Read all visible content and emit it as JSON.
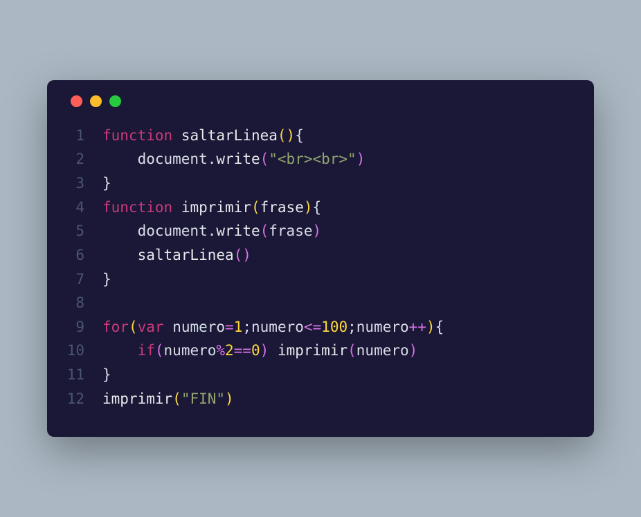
{
  "window": {
    "dots": [
      "red",
      "yellow",
      "green"
    ]
  },
  "code": {
    "lines": [
      {
        "no": "1",
        "tokens": [
          [
            "kw",
            "function"
          ],
          [
            "",
            ", "
          ],
          [
            "fn",
            "saltarLinea"
          ],
          [
            "paren-y",
            "()"
          ],
          [
            "punct",
            "{"
          ]
        ],
        "indent": 0
      },
      {
        "no": "2",
        "tokens": [
          [
            "",
            "document"
          ],
          [
            "punct",
            "."
          ],
          [
            "fn",
            "write"
          ],
          [
            "paren-p",
            "("
          ],
          [
            "str",
            "\"<br><br>\""
          ],
          [
            "paren-p",
            ")"
          ]
        ],
        "indent": 1
      },
      {
        "no": "3",
        "tokens": [
          [
            "punct",
            "}"
          ]
        ],
        "indent": 0
      },
      {
        "no": "4",
        "tokens": [
          [
            "kw",
            "function"
          ],
          [
            "",
            ", "
          ],
          [
            "fn",
            "imprimir"
          ],
          [
            "paren-y",
            "("
          ],
          [
            "param",
            "frase"
          ],
          [
            "paren-y",
            ")"
          ],
          [
            "punct",
            "{"
          ]
        ],
        "indent": 0
      },
      {
        "no": "5",
        "tokens": [
          [
            "",
            "document"
          ],
          [
            "punct",
            "."
          ],
          [
            "fn",
            "write"
          ],
          [
            "paren-p",
            "("
          ],
          [
            "",
            "frase"
          ],
          [
            "paren-p",
            ")"
          ]
        ],
        "indent": 1
      },
      {
        "no": "6",
        "tokens": [
          [
            "fn",
            "saltarLinea"
          ],
          [
            "paren-p",
            "()"
          ]
        ],
        "indent": 1
      },
      {
        "no": "7",
        "tokens": [
          [
            "punct",
            "}"
          ]
        ],
        "indent": 0
      },
      {
        "no": "8",
        "tokens": [],
        "indent": 0
      },
      {
        "no": "9",
        "tokens": [
          [
            "kw",
            "for"
          ],
          [
            "paren-y",
            "("
          ],
          [
            "kw",
            "var"
          ],
          [
            "",
            ", "
          ],
          [
            "",
            "numero"
          ],
          [
            "op",
            "="
          ],
          [
            "num",
            "1"
          ],
          [
            "punct",
            ";"
          ],
          [
            "",
            "numero"
          ],
          [
            "op",
            "<="
          ],
          [
            "num",
            "100"
          ],
          [
            "punct",
            ";"
          ],
          [
            "",
            "numero"
          ],
          [
            "op",
            "++"
          ],
          [
            "paren-y",
            ")"
          ],
          [
            "punct",
            "{"
          ]
        ],
        "indent": 0
      },
      {
        "no": "10",
        "tokens": [
          [
            "kw",
            "if"
          ],
          [
            "paren-p",
            "("
          ],
          [
            "",
            "numero"
          ],
          [
            "op",
            "%"
          ],
          [
            "num",
            "2"
          ],
          [
            "op",
            "=="
          ],
          [
            "num",
            "0"
          ],
          [
            "paren-p",
            ")"
          ],
          [
            "",
            ", "
          ],
          [
            "fn",
            "imprimir"
          ],
          [
            "paren-p",
            "("
          ],
          [
            "",
            "numero"
          ],
          [
            "paren-p",
            ")"
          ]
        ],
        "indent": 1
      },
      {
        "no": "11",
        "tokens": [
          [
            "punct",
            "}"
          ]
        ],
        "indent": 0
      },
      {
        "no": "12",
        "tokens": [
          [
            "fn",
            "imprimir"
          ],
          [
            "paren-y",
            "("
          ],
          [
            "str",
            "\"FIN\""
          ],
          [
            "paren-y",
            ")"
          ]
        ],
        "indent": 0
      }
    ]
  }
}
